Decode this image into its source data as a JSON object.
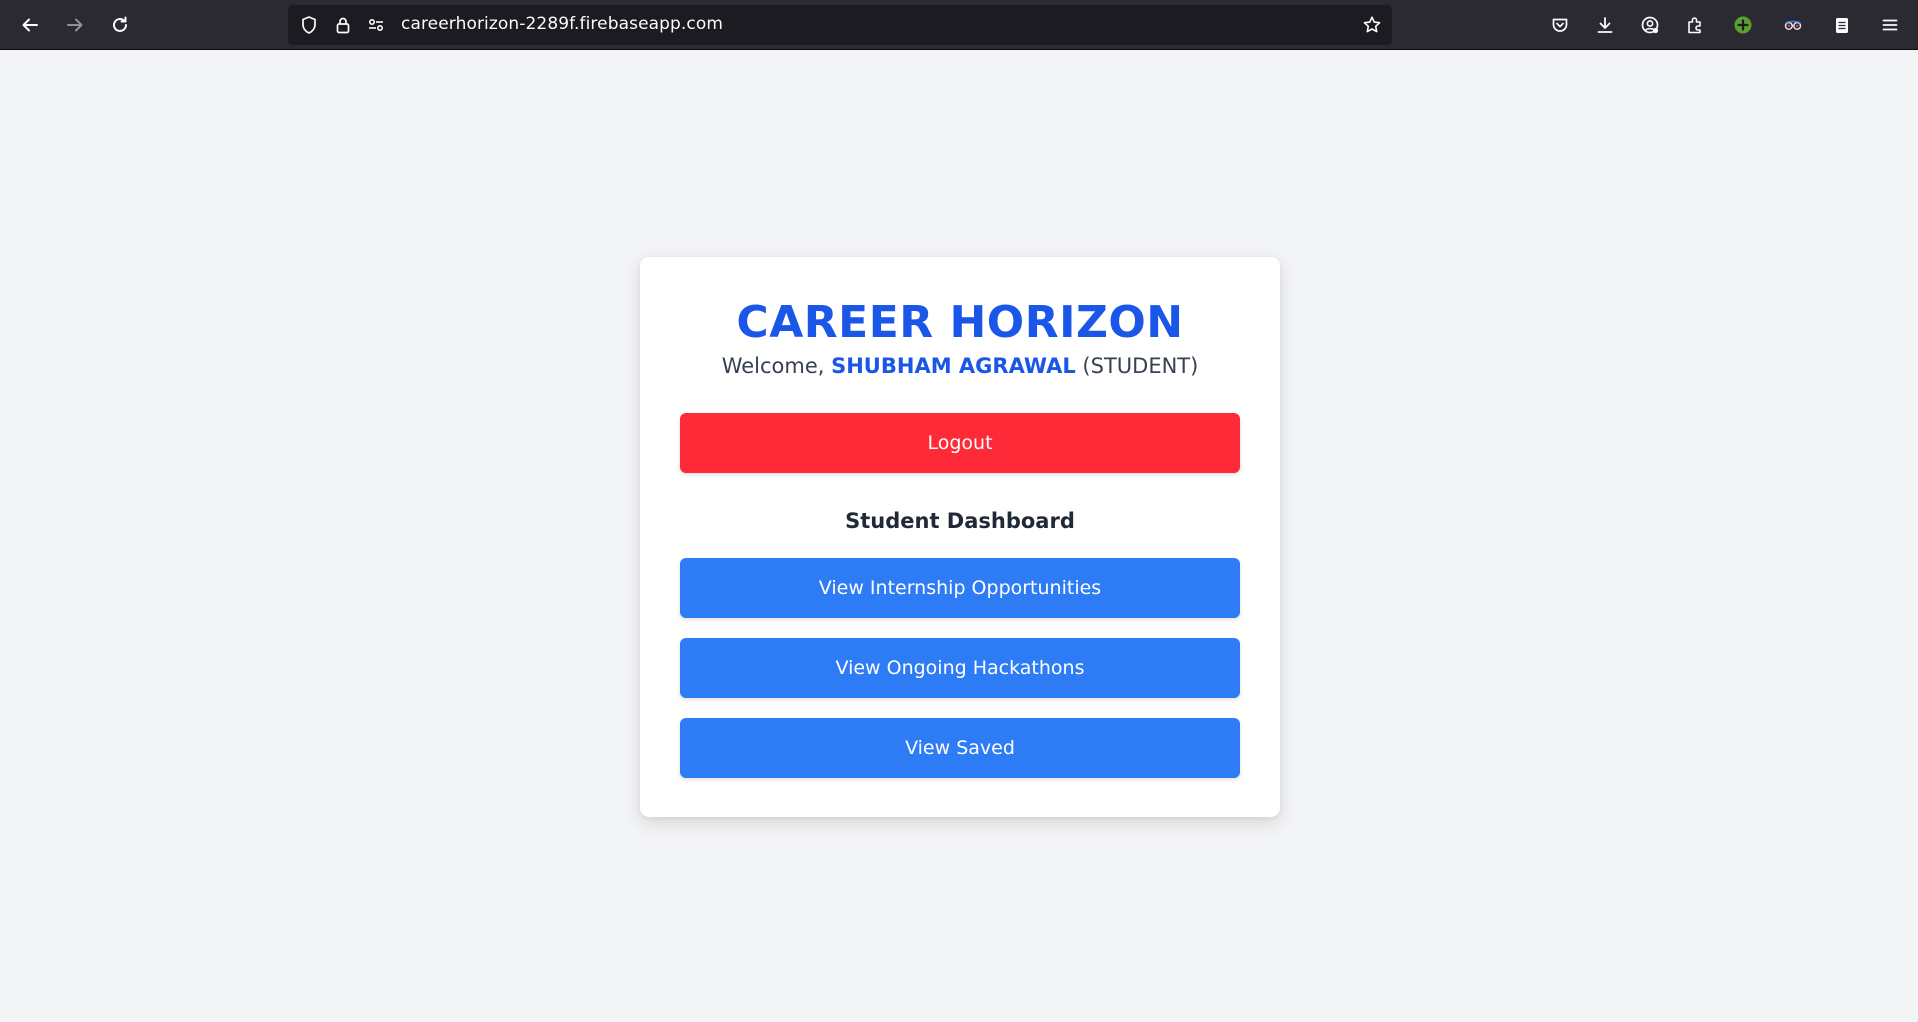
{
  "browser": {
    "url": "careerhorizon-2289f.firebaseapp.com",
    "extension_badge_color": "#5aa02c"
  },
  "app": {
    "title": "CAREER HORIZON",
    "welcome_prefix": "Welcome,",
    "user_name": "SHUBHAM AGRAWAL",
    "user_role": "(STUDENT)",
    "logout_label": "Logout",
    "dashboard_title": "Student Dashboard",
    "actions": [
      {
        "label": "View Internship Opportunities"
      },
      {
        "label": "View Ongoing Hackathons"
      },
      {
        "label": "View Saved"
      }
    ]
  },
  "colors": {
    "brand": "#1a56e8",
    "primary_button": "#2e7bf6",
    "danger_button": "#ff2a37",
    "page_bg": "#f3f4f6"
  }
}
